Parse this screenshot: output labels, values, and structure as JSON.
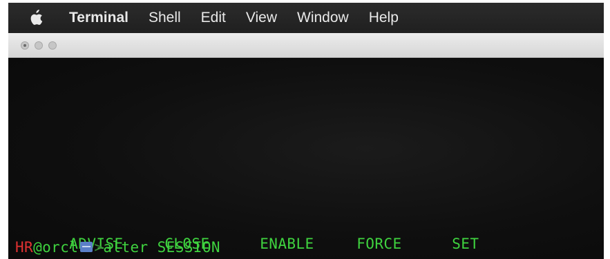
{
  "menubar": {
    "apple_icon": "apple-icon",
    "items": [
      "Terminal",
      "Shell",
      "Edit",
      "View",
      "Window",
      "Help"
    ]
  },
  "window": {
    "traffic_lights": [
      "close-button",
      "minimize-button",
      "zoom-button"
    ]
  },
  "terminal": {
    "completions": [
      "ADVISE",
      "CLOSE",
      "ENABLE",
      "FORCE",
      "SET"
    ],
    "prompt": {
      "user": "HR",
      "host": "@orcl",
      "badge_icon": "database-icon",
      "arrow": ">",
      "command": "alter SESSION"
    },
    "colors": {
      "background": "#0f0f0f",
      "text": "#3fd33f",
      "user": "#e03131"
    }
  }
}
